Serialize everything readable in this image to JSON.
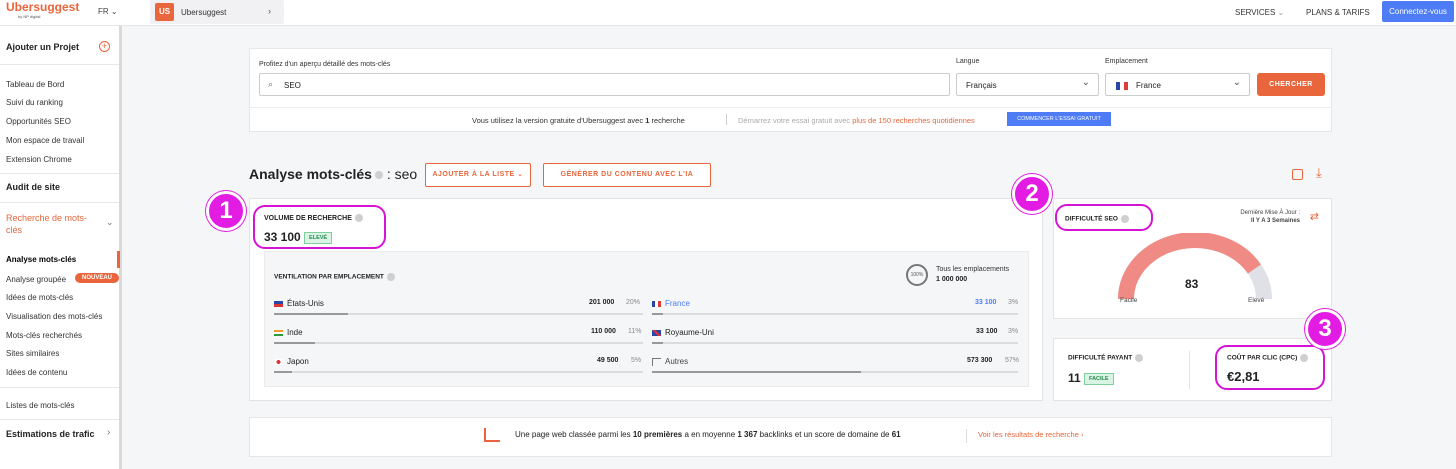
{
  "brand": {
    "name": "Ubersuggest",
    "sub": "by NP digital"
  },
  "header": {
    "lang": "FR",
    "project_badge": "US",
    "project_name": "Ubersuggest",
    "services": "SERVICES",
    "plans": "PLANS & TARIFS",
    "connect": "Connectez-vous"
  },
  "sidebar": {
    "add_project": "Ajouter un Projet",
    "items1": [
      "Tableau de Bord",
      "Suivi du ranking",
      "Opportunités SEO",
      "Mon espace de travail",
      "Extension Chrome"
    ],
    "audit": "Audit de site",
    "research_line1": "Recherche de mots-",
    "research_line2": "clés",
    "items2": [
      "Analyse mots-clés",
      "Analyse groupée",
      "Idées de mots-clés",
      "Visualisation des mots-clés",
      "Mots-clés recherchés",
      "Sites similaires",
      "Idées de contenu"
    ],
    "badge_new": "NOUVEAU",
    "lists": "Listes de mots-clés",
    "traffic": "Estimations de trafic"
  },
  "search": {
    "label": "Profitez d'un aperçu détaillé des mots-clés",
    "value": "SEO",
    "lang_label": "Langue",
    "lang_value": "Français",
    "loc_label": "Emplacement",
    "loc_value": "France",
    "button": "CHERCHER",
    "free_text_a": "Vous utilisez la version gratuite d'Ubersuggest avec ",
    "free_text_b": "1",
    "free_text_c": " recherche",
    "free_text2_a": "Démarrez votre essai gratuit avec ",
    "free_text2_b": "plus de 150 recherches quotidiennes",
    "trial_button": "COMMENCER L'ESSAI GRATUIT"
  },
  "analysis": {
    "title": "Analyse mots-clés",
    "keyword": ": seo",
    "add_list": "AJOUTER À LA LISTE",
    "generate": "GÉNÉRER DU CONTENU AVEC L'IA"
  },
  "volume": {
    "label": "VOLUME DE RECHERCHE",
    "value": "33 100",
    "badge": "ELEVÉ"
  },
  "ventilation": {
    "label": "VENTILATION PAR EMPLACEMENT",
    "all_label": "Tous les emplacements",
    "all_value": "1 000 000",
    "circle": "100%",
    "rows": [
      {
        "country": "États-Unis",
        "value": "201 000",
        "pct": "20%",
        "fill": 0.2
      },
      {
        "country": "Inde",
        "value": "110 000",
        "pct": "11%",
        "fill": 0.11
      },
      {
        "country": "Japon",
        "value": "49 500",
        "pct": "5%",
        "fill": 0.05
      },
      {
        "country": "France",
        "value": "33 100",
        "pct": "3%",
        "fill": 0.03
      },
      {
        "country": "Royaume-Uni",
        "value": "33 100",
        "pct": "3%",
        "fill": 0.03
      },
      {
        "country": "Autres",
        "value": "573 300",
        "pct": "57%",
        "fill": 0.57
      }
    ]
  },
  "seo_difficulty": {
    "label": "DIFFICULTÉ SEO",
    "updated_label": "Dernière Mise À Jour :",
    "updated_value": "Il Y A 3 Semaines",
    "value": "83",
    "level": 0.83,
    "easy": "Facile",
    "high": "Elevé"
  },
  "paid": {
    "label": "DIFFICULTÉ PAYANT",
    "value": "11",
    "badge": "FACILE"
  },
  "cpc": {
    "label": "COÛT PAR CLIC (CPC)",
    "value": "€2,81"
  },
  "annotations": [
    "1",
    "2",
    "3"
  ],
  "bottom": {
    "text_a": "Une page web classée parmi les ",
    "text_b": "10 premières",
    "text_c": " a en moyenne ",
    "text_d": "1 367",
    "text_e": " backlinks et un ",
    "text_f": "score de domaine de ",
    "text_g": "61",
    "link": "Voir les résultats de recherche"
  },
  "colors": {
    "accent": "#e9653b",
    "blue": "#4d7cf6",
    "annotation": "#e21ce2",
    "gauge": "#ef8b84"
  }
}
